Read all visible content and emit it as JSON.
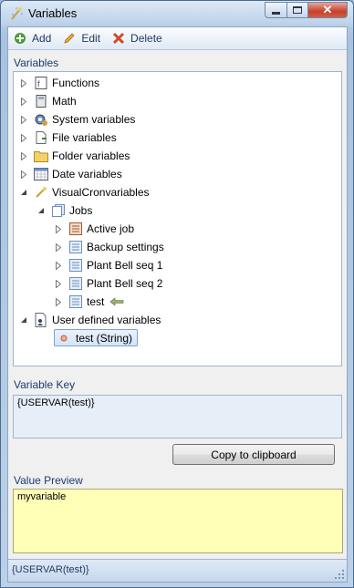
{
  "window": {
    "title": "Variables",
    "icon": "wand-icon"
  },
  "toolbar": {
    "add_label": "Add",
    "edit_label": "Edit",
    "delete_label": "Delete"
  },
  "tree": {
    "group_label": "Variables",
    "nodes": {
      "functions": "Functions",
      "math": "Math",
      "system": "System variables",
      "file": "File variables",
      "folder": "Folder variables",
      "date": "Date variables",
      "visualcron": "VisualCronvariables",
      "jobs": "Jobs",
      "active_job": "Active job",
      "backup": "Backup settings",
      "plant1": "Plant Bell seq 1",
      "plant2": "Plant Bell seq 2",
      "test": "test",
      "user_defined": "User defined variables",
      "test_string": "test (String)"
    }
  },
  "variable_key": {
    "label": "Variable Key",
    "value": "{USERVAR(test)}"
  },
  "copy_button": "Copy to clipboard",
  "value_preview": {
    "label": "Value Preview",
    "value": "myvariable"
  },
  "status": "{USERVAR(test)}",
  "colors": {
    "accent": "#1f3a66",
    "selection": "#d3e4f8",
    "preview_bg": "#ffffb8"
  }
}
